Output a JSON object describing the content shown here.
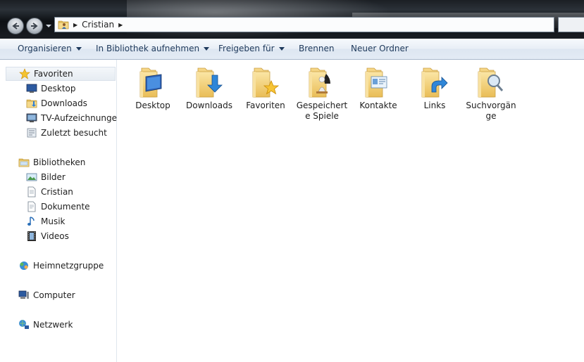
{
  "window": {
    "address": {
      "crumb": "Cristian"
    }
  },
  "toolbar": {
    "organize": "Organisieren",
    "add_library": "In Bibliothek aufnehmen",
    "share": "Freigeben für",
    "burn": "Brennen",
    "new_folder": "Neuer Ordner"
  },
  "sidebar": {
    "favorites": {
      "header": "Favoriten",
      "items": [
        "Desktop",
        "Downloads",
        "TV-Aufzeichnungen",
        "Zuletzt besucht"
      ]
    },
    "libraries": {
      "header": "Bibliotheken",
      "items": [
        "Bilder",
        "Cristian",
        "Dokumente",
        "Musik",
        "Videos"
      ]
    },
    "homegroup": "Heimnetzgruppe",
    "computer": "Computer",
    "network": "Netzwerk"
  },
  "content": {
    "folders": [
      {
        "label": "Desktop",
        "icon": "desktop-folder-icon"
      },
      {
        "label": "Downloads",
        "icon": "downloads-folder-icon"
      },
      {
        "label": "Favoriten",
        "icon": "favorites-folder-icon"
      },
      {
        "label": "Gespeicherte Spiele",
        "icon": "saved-games-folder-icon"
      },
      {
        "label": "Kontakte",
        "icon": "contacts-folder-icon"
      },
      {
        "label": "Links",
        "icon": "links-folder-icon"
      },
      {
        "label": "Suchvorgänge",
        "icon": "searches-folder-icon"
      }
    ]
  },
  "colors": {
    "toolbar_text": "#1e395b",
    "folder_yellow": "#f3d27a",
    "selection": "#e6ecf2"
  }
}
